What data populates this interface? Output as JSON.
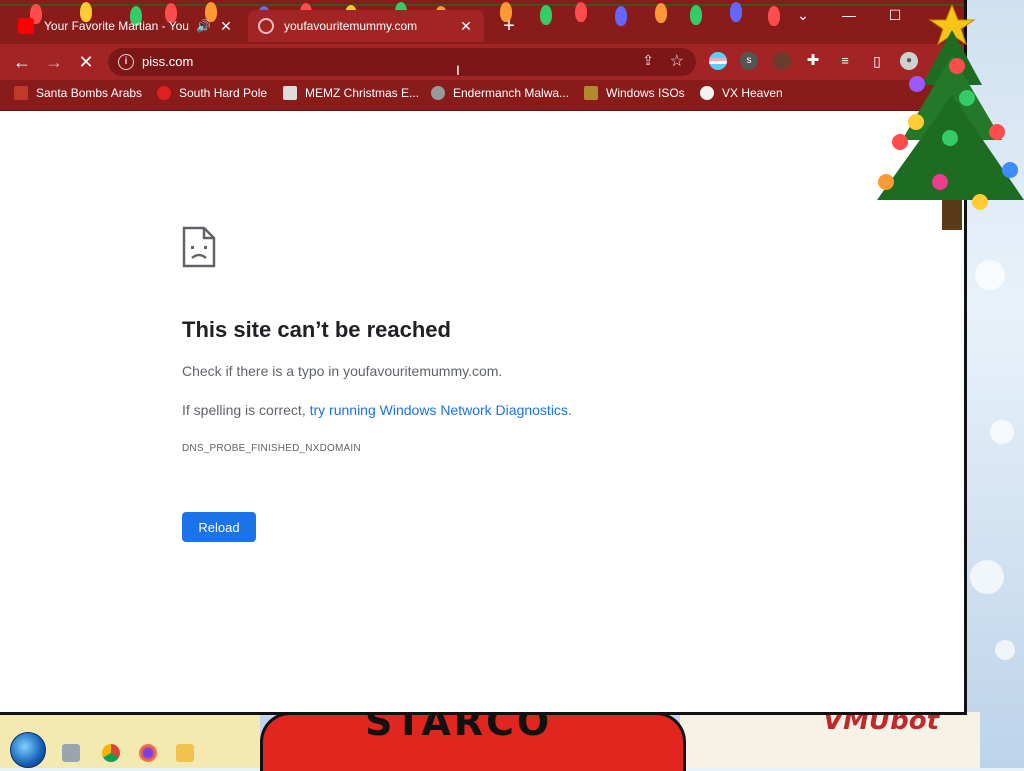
{
  "browser": {
    "tabs": [
      {
        "title": "Your Favorite Martian - You",
        "active": false,
        "has_audio": true
      },
      {
        "title": "youfavouritemummy.com",
        "active": true,
        "has_audio": false
      }
    ],
    "new_tab_label": "+",
    "address_bar": {
      "url": "piss.com"
    }
  },
  "bookmarks": [
    {
      "label": "Santa Bombs Arabs",
      "icon": "santa-icon"
    },
    {
      "label": "South Hard Pole",
      "icon": "red-star-icon"
    },
    {
      "label": "MEMZ Christmas E...",
      "icon": "image-icon"
    },
    {
      "label": "Endermanch Malwa...",
      "icon": "raccoon-icon"
    },
    {
      "label": "Windows ISOs",
      "icon": "figure-icon"
    },
    {
      "label": "VX Heaven",
      "icon": "radiation-icon"
    }
  ],
  "error_page": {
    "title": "This site can’t be reached",
    "line1": "Check if there is a typo in youfavouritemummy.com.",
    "line2_prefix": "If spelling is correct, ",
    "line2_link": "try running Windows Network Diagnostics",
    "line2_suffix": ".",
    "code": "DNS_PROBE_FINISHED_NXDOMAIN",
    "reload_label": "Reload"
  },
  "desktop": {
    "wallpaper_text": "STARCO",
    "corner_text": "VMUbot"
  },
  "colors": {
    "titlebar": "#8a1b1b",
    "toolbar": "#a32424",
    "link": "#1a73e8",
    "button": "#1a73e8"
  }
}
